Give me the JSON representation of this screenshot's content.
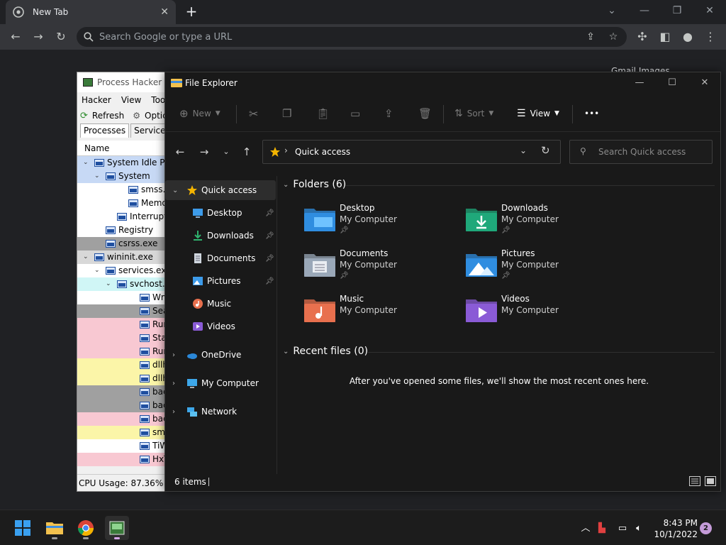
{
  "chrome": {
    "tab_title": "New Tab",
    "new_tab": "+",
    "omnibox_placeholder": "Search Google or type a URL",
    "gmail_links": "Gmail   Images"
  },
  "process_hacker": {
    "title": "Process Hacker [C",
    "menu": [
      "Hacker",
      "View",
      "Tools"
    ],
    "toolbar": [
      "Refresh",
      "Optic"
    ],
    "tabs": [
      "Processes",
      "Services"
    ],
    "column_name": "Name",
    "rows": [
      {
        "name": "System Idle Pro",
        "indent": 0,
        "arrow": "v",
        "bg": "#c7d9f5"
      },
      {
        "name": "System",
        "indent": 1,
        "arrow": "v",
        "bg": "#c7d9f5"
      },
      {
        "name": "smss.exe",
        "indent": 3,
        "arrow": "",
        "bg": "#ffffff"
      },
      {
        "name": "Memory",
        "indent": 3,
        "arrow": "",
        "bg": "#ffffff"
      },
      {
        "name": "Interrupts",
        "indent": 2,
        "arrow": "",
        "bg": "#ffffff"
      },
      {
        "name": "Registry",
        "indent": 1,
        "arrow": "",
        "bg": "#ffffff"
      },
      {
        "name": "csrss.exe",
        "indent": 1,
        "arrow": "",
        "bg": "#a0a0a0"
      },
      {
        "name": "wininit.exe",
        "indent": 0,
        "arrow": "v",
        "bg": "#d8d8d8"
      },
      {
        "name": "services.exe",
        "indent": 1,
        "arrow": "v",
        "bg": "#ffffff"
      },
      {
        "name": "svchost.",
        "indent": 2,
        "arrow": "v",
        "bg": "#d0f6f6"
      },
      {
        "name": "WmiP",
        "indent": 4,
        "arrow": "",
        "bg": "#ffffff"
      },
      {
        "name": "Searc",
        "indent": 4,
        "arrow": "",
        "bg": "#a0a0a0"
      },
      {
        "name": "Runti",
        "indent": 4,
        "arrow": "",
        "bg": "#f8c8d2"
      },
      {
        "name": "StartM",
        "indent": 4,
        "arrow": "",
        "bg": "#f8c8d2"
      },
      {
        "name": "Runti",
        "indent": 4,
        "arrow": "",
        "bg": "#f8c8d2"
      },
      {
        "name": "dllho",
        "indent": 4,
        "arrow": "",
        "bg": "#fbf5a8"
      },
      {
        "name": "dllho",
        "indent": 4,
        "arrow": "",
        "bg": "#fbf5a8"
      },
      {
        "name": "backg",
        "indent": 4,
        "arrow": "",
        "bg": "#a0a0a0"
      },
      {
        "name": "backg",
        "indent": 4,
        "arrow": "",
        "bg": "#a0a0a0"
      },
      {
        "name": "backg",
        "indent": 4,
        "arrow": "",
        "bg": "#f8c8d2"
      },
      {
        "name": "smart",
        "indent": 4,
        "arrow": "",
        "bg": "#fbf5a8"
      },
      {
        "name": "TiWo",
        "indent": 4,
        "arrow": "",
        "bg": "#ffffff"
      },
      {
        "name": "HxTsr",
        "indent": 4,
        "arrow": "",
        "bg": "#f8c8d2"
      }
    ],
    "status": "CPU Usage: 87.36%",
    "status_extra": "P"
  },
  "explorer": {
    "title": "File Explorer",
    "cmd": {
      "new": "New",
      "sort": "Sort",
      "view": "View",
      "more": "•••"
    },
    "address": "Quick access",
    "search_placeholder": "Search Quick access",
    "nav": [
      {
        "label": "Quick access",
        "level": 0,
        "chevron": "v",
        "icon": "star",
        "pinned": false,
        "selected": true
      },
      {
        "label": "Desktop",
        "level": 1,
        "chevron": "",
        "icon": "desktop",
        "pinned": true,
        "selected": false
      },
      {
        "label": "Downloads",
        "level": 1,
        "chevron": "",
        "icon": "download",
        "pinned": true,
        "selected": false
      },
      {
        "label": "Documents",
        "level": 1,
        "chevron": "",
        "icon": "document",
        "pinned": true,
        "selected": false
      },
      {
        "label": "Pictures",
        "level": 1,
        "chevron": "",
        "icon": "picture",
        "pinned": true,
        "selected": false
      },
      {
        "label": "Music",
        "level": 1,
        "chevron": "",
        "icon": "music",
        "pinned": false,
        "selected": false
      },
      {
        "label": "Videos",
        "level": 1,
        "chevron": "",
        "icon": "video",
        "pinned": false,
        "selected": false
      },
      {
        "label": "OneDrive",
        "level": 0,
        "chevron": ">",
        "icon": "cloud",
        "pinned": false,
        "selected": false
      },
      {
        "label": "My Computer",
        "level": 0,
        "chevron": ">",
        "icon": "computer",
        "pinned": false,
        "selected": false
      },
      {
        "label": "Network",
        "level": 0,
        "chevron": ">",
        "icon": "network",
        "pinned": false,
        "selected": false
      }
    ],
    "folders_heading": "Folders (6)",
    "folders": [
      {
        "name": "Desktop",
        "location": "My Computer",
        "pinned": true,
        "icon": "desktop-folder"
      },
      {
        "name": "Downloads",
        "location": "My Computer",
        "pinned": true,
        "icon": "downloads-folder"
      },
      {
        "name": "Documents",
        "location": "My Computer",
        "pinned": true,
        "icon": "documents-folder"
      },
      {
        "name": "Pictures",
        "location": "My Computer",
        "pinned": true,
        "icon": "pictures-folder"
      },
      {
        "name": "Music",
        "location": "My Computer",
        "pinned": false,
        "icon": "music-folder"
      },
      {
        "name": "Videos",
        "location": "My Computer",
        "pinned": false,
        "icon": "videos-folder"
      }
    ],
    "recent_heading": "Recent files (0)",
    "recent_empty": "After you've opened some files, we'll show the most recent ones here.",
    "status_items": "6 items"
  },
  "taskbar": {
    "time": "8:43 PM",
    "date": "10/1/2022",
    "notifications": "2"
  }
}
